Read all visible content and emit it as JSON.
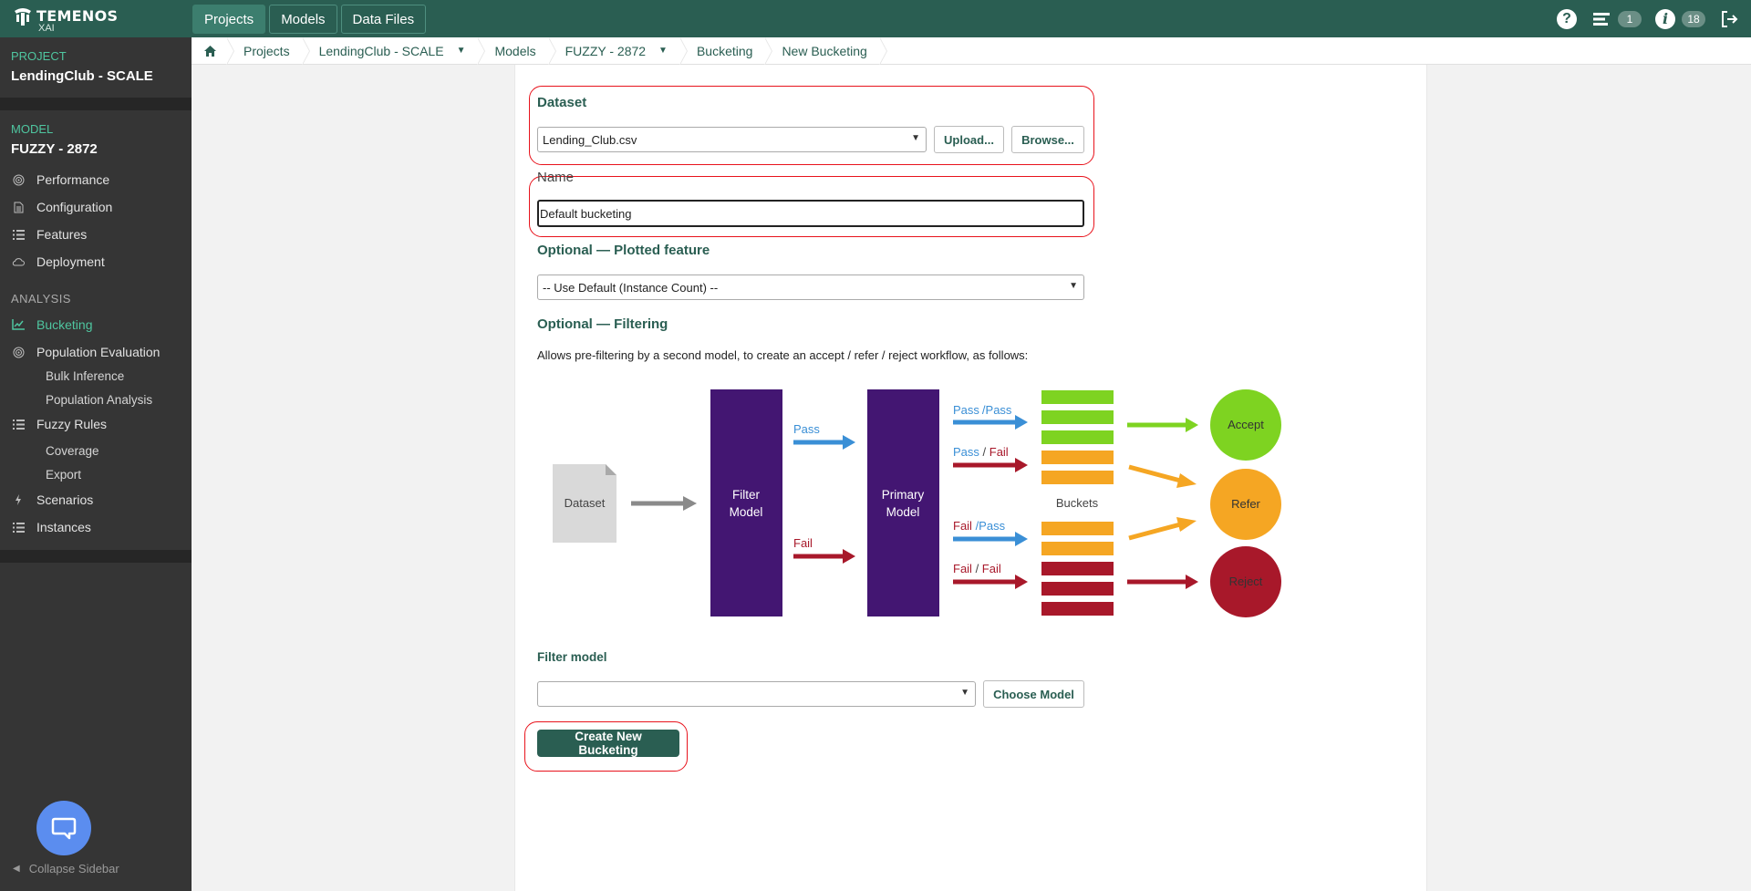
{
  "header": {
    "logo_text": "TEMENOS",
    "logo_sub": "XAI",
    "nav": [
      {
        "label": "Projects"
      },
      {
        "label": "Models"
      },
      {
        "label": "Data Files"
      }
    ],
    "badge_tasks": "1",
    "badge_info": "18"
  },
  "sidebar": {
    "project_label": "PROJECT",
    "project_name": "LendingClub - SCALE",
    "model_label": "MODEL",
    "model_name": "FUZZY - 2872",
    "model_items": [
      {
        "label": "Performance",
        "icon": "target-icon"
      },
      {
        "label": "Configuration",
        "icon": "document-icon"
      },
      {
        "label": "Features",
        "icon": "list-icon"
      },
      {
        "label": "Deployment",
        "icon": "cloud-icon"
      }
    ],
    "analysis_label": "ANALYSIS",
    "analysis_items": [
      {
        "label": "Bucketing",
        "icon": "chart-icon"
      },
      {
        "label": "Population Evaluation",
        "icon": "target-icon"
      }
    ],
    "population_sub": [
      "Bulk Inference",
      "Population Analysis"
    ],
    "fuzzy_rules": "Fuzzy Rules",
    "fuzzy_sub": [
      "Coverage",
      "Export"
    ],
    "scenarios": "Scenarios",
    "instances": "Instances",
    "collapse": "Collapse Sidebar"
  },
  "breadcrumb": [
    "Projects",
    "LendingClub - SCALE",
    "Models",
    "FUZZY - 2872",
    "Bucketing",
    "New Bucketing"
  ],
  "form": {
    "dataset_heading": "Dataset",
    "dataset_value": "Lending_Club.csv",
    "upload_label": "Upload...",
    "browse_label": "Browse...",
    "name_heading": "Name",
    "name_value": "Default bucketing",
    "plotted_heading": "Optional — Plotted feature",
    "plotted_value": "-- Use Default (Instance Count) --",
    "filtering_heading": "Optional — Filtering",
    "filtering_desc": "Allows pre-filtering by a second model, to create an accept / refer / reject workflow, as follows:",
    "filter_model_heading": "Filter model",
    "filter_model_value": "",
    "choose_model_label": "Choose Model",
    "create_label": "Create New Bucketing"
  },
  "diagram": {
    "dataset": "Dataset",
    "filter_model": [
      "Filter",
      "Model"
    ],
    "primary_model": [
      "Primary",
      "Model"
    ],
    "pass": "Pass",
    "fail": "Fail",
    "pass_pass": [
      "Pass",
      "/Pass"
    ],
    "pass_fail": [
      "Pass",
      " / ",
      "Fail"
    ],
    "fail_pass": [
      "Fail",
      " /Pass"
    ],
    "fail_fail": [
      "Fail",
      " / ",
      "Fail"
    ],
    "buckets": "Buckets",
    "accept": "Accept",
    "refer": "Refer",
    "reject": "Reject"
  },
  "colors": {
    "brand": "#2a5e52",
    "accent": "#4fc6a0",
    "model_box": "#431672",
    "green": "#7ed321",
    "orange": "#f5a623",
    "red": "#a8182a",
    "blue": "#3a8fd6"
  }
}
